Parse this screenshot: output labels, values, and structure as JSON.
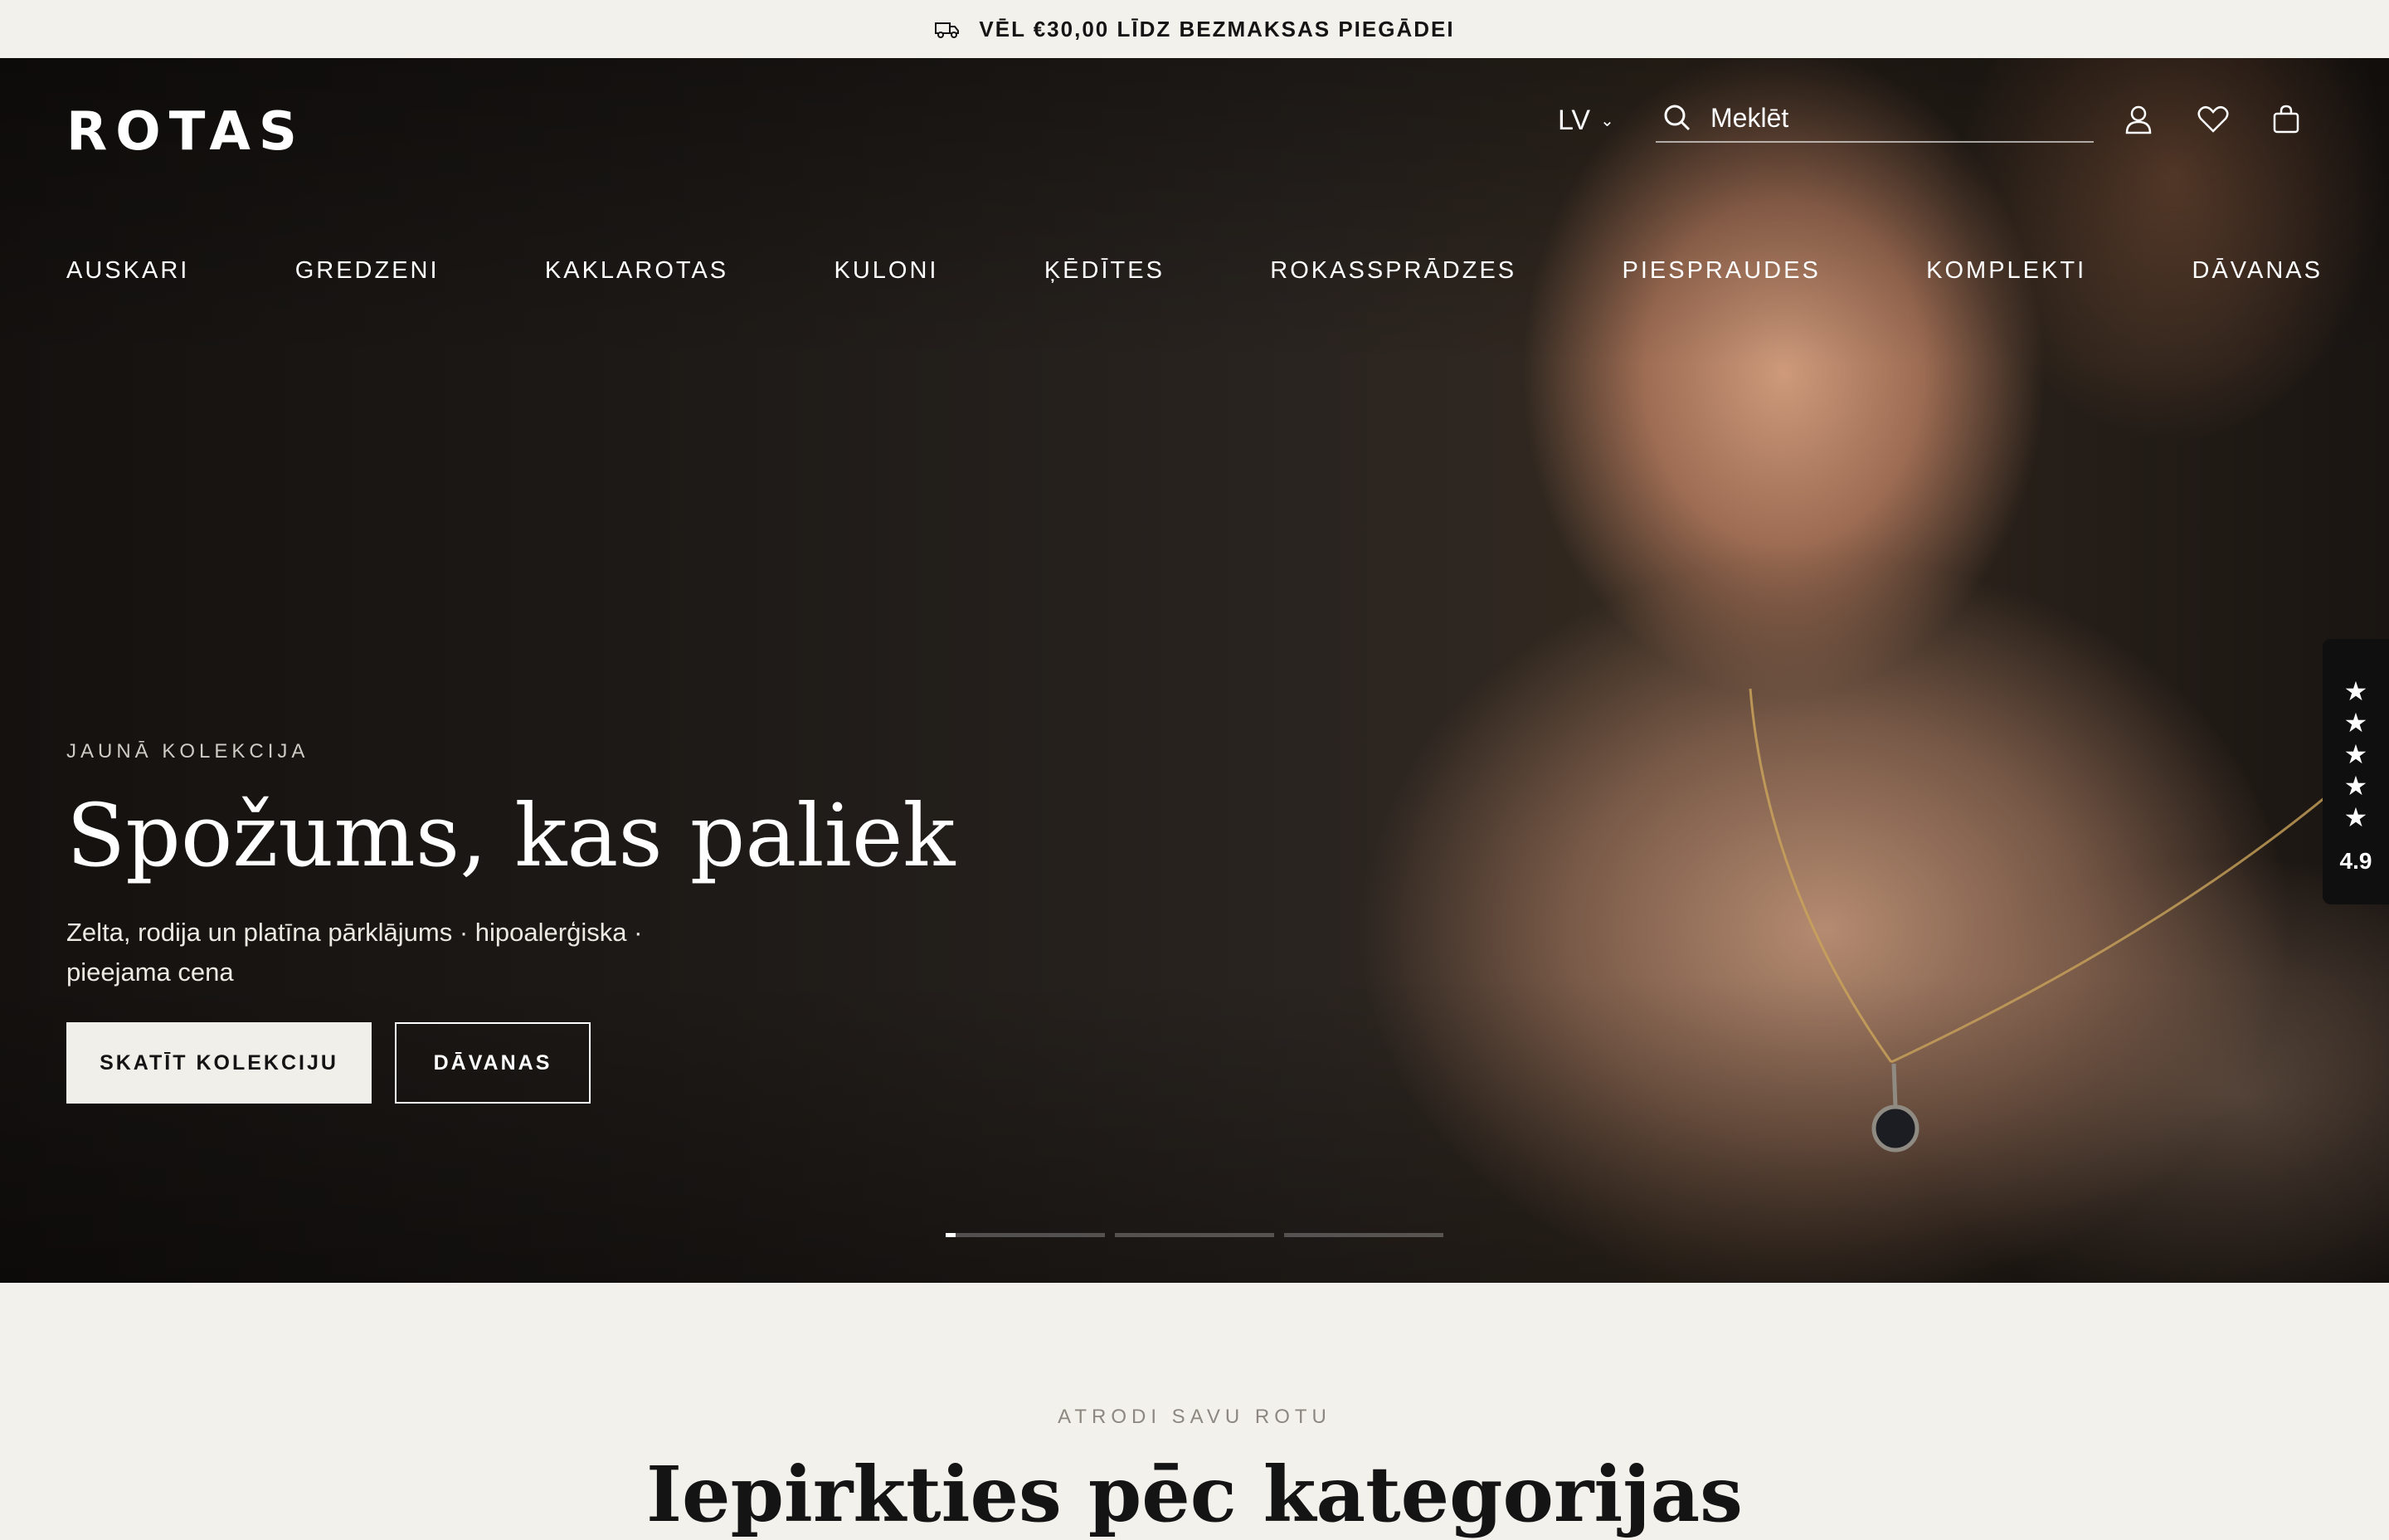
{
  "announcement": {
    "text": "VĒL €30,00 LĪDZ BEZMAKSAS PIEGĀDEI",
    "icon": "truck-icon"
  },
  "header": {
    "logo": "ROTAS",
    "language": "LV",
    "search_placeholder": "Meklēt",
    "icons": [
      "search-icon",
      "account-icon",
      "wishlist-icon",
      "cart-icon"
    ]
  },
  "nav": {
    "items": [
      {
        "label": "AUSKARI"
      },
      {
        "label": "GREDZENI"
      },
      {
        "label": "KAKLAROTAS"
      },
      {
        "label": "KULONI"
      },
      {
        "label": "ĶĒDĪTES"
      },
      {
        "label": "ROKASSPRĀDZES"
      },
      {
        "label": "PIESPRAUDES"
      },
      {
        "label": "KOMPLEKTI"
      },
      {
        "label": "DĀVANAS"
      }
    ]
  },
  "hero": {
    "eyebrow": "JAUNĀ KOLEKCIJA",
    "headline": "Spožums, kas paliek",
    "subtitle": "Zelta, rodija un platīna pārklājums · hipoalerģiska · pieejama cena",
    "primary_button": "SKATĪT KOLEKCIJU",
    "secondary_button": "DĀVANAS",
    "slides": 3,
    "active_slide": 1
  },
  "rating": {
    "stars": 5,
    "score": "4.9"
  },
  "categories": {
    "eyebrow": "ATRODI SAVU ROTU",
    "title": "Iepirkties pēc kategorijas"
  },
  "colors": {
    "background": "#f3f1ec",
    "hero_dark": "#1e1a17",
    "text": "#141414",
    "white": "#ffffff"
  }
}
